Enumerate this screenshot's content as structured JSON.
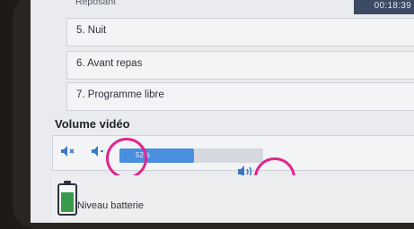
{
  "status_bar": {
    "time": "00:18:39"
  },
  "list": {
    "partial_item": "Reposant",
    "items": [
      {
        "label": "5. Nuit"
      },
      {
        "label": "6. Avant repas"
      },
      {
        "label": "7. Programme libre"
      }
    ]
  },
  "volume_section": {
    "title": "Volume vidéo",
    "slider_value_text": "52%",
    "slider_level": 0.52
  },
  "battery": {
    "label": "Niveau batterie"
  },
  "colors": {
    "accent": "#4a8ee0",
    "highlight": "#e0258f",
    "battery_green": "#3a9a4e"
  },
  "icons": [
    "mute-icon",
    "volume-down-icon",
    "volume-up-icon",
    "battery-icon"
  ]
}
